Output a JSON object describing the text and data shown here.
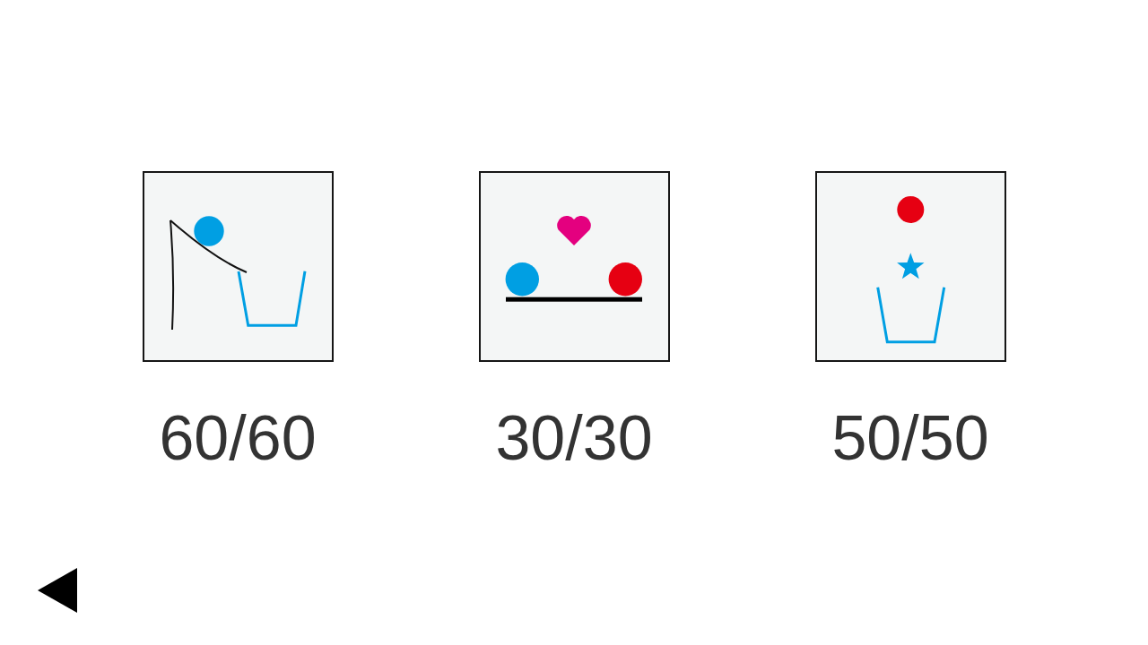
{
  "levels": [
    {
      "kind": "ramp-cup",
      "score": "60/60"
    },
    {
      "kind": "balance",
      "score": "30/30"
    },
    {
      "kind": "star-cup",
      "score": "50/50"
    }
  ]
}
